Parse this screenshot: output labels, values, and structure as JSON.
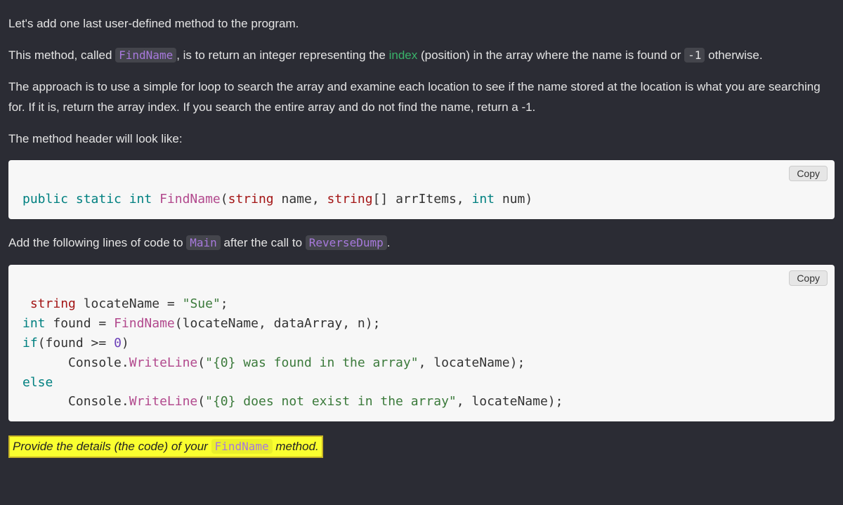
{
  "intro": {
    "p1": "Let's add one last user-defined method to the program.",
    "p2_a": "This method, called ",
    "p2_code": "FindName",
    "p2_b": ", is to return an integer representing the ",
    "p2_index": "index",
    "p2_c": " (position) in the array where the name is found or ",
    "p2_neg1": "-1",
    "p2_d": " otherwise.",
    "p3": "The approach is to use a simple for loop to search the array and examine each location to see if the name stored at the location is what you are searching for. If it is, return the array index. If you search the entire array and do not find the name, return a -1.",
    "p4": "The method header will look like:"
  },
  "copy": "Copy",
  "header_code": {
    "kw1": "public static ",
    "kw2": "int",
    "sp1": " ",
    "fn": "FindName",
    "paren_o": "(",
    "type1": "string",
    "arg1": " name",
    "comma1": ", ",
    "type2": "string",
    "brackets": "[]",
    "arg2": " arrItems",
    "comma2": ", ",
    "kw3": "int",
    "arg3": " num",
    "paren_c": ")"
  },
  "middle": {
    "a": "Add the following lines of code to ",
    "main": "Main",
    "b": " after the call to ",
    "rd": "ReverseDump",
    "c": "."
  },
  "main_code": {
    "l1_sp": " ",
    "l1_type": "string",
    "l1_var": " locateName ",
    "l1_eq": "=",
    "l1_sp2": " ",
    "l1_str": "\"Sue\"",
    "l1_end": ";",
    "l2_type": "int",
    "l2_var": " found ",
    "l2_eq": "=",
    "l2_sp": " ",
    "l2_fn": "FindName",
    "l2_paren": "(locateName",
    "l2_c1": ", ",
    "l2_a2": "dataArray",
    "l2_c2": ", ",
    "l2_a3": "n",
    "l2_end": ");",
    "l3_if": "if",
    "l3_cond_a": "(found ",
    "l3_op": ">=",
    "l3_sp": " ",
    "l3_zero": "0",
    "l3_cond_b": ")",
    "l4_indent": "      ",
    "l4_console": "Console",
    "l4_dot": ".",
    "l4_wl": "WriteLine",
    "l4_paren": "(",
    "l4_str": "\"{0} was found in the array\"",
    "l4_rest": ", locateName);",
    "l5_else": "else",
    "l6_indent": "      ",
    "l6_console": "Console",
    "l6_dot": ".",
    "l6_wl": "WriteLine",
    "l6_paren": "(",
    "l6_str": "\"{0} does not exist in the array\"",
    "l6_rest": ", locateName);"
  },
  "prompt": {
    "a": "Provide the details (the code) of your ",
    "code": "FindName",
    "b": " method."
  }
}
